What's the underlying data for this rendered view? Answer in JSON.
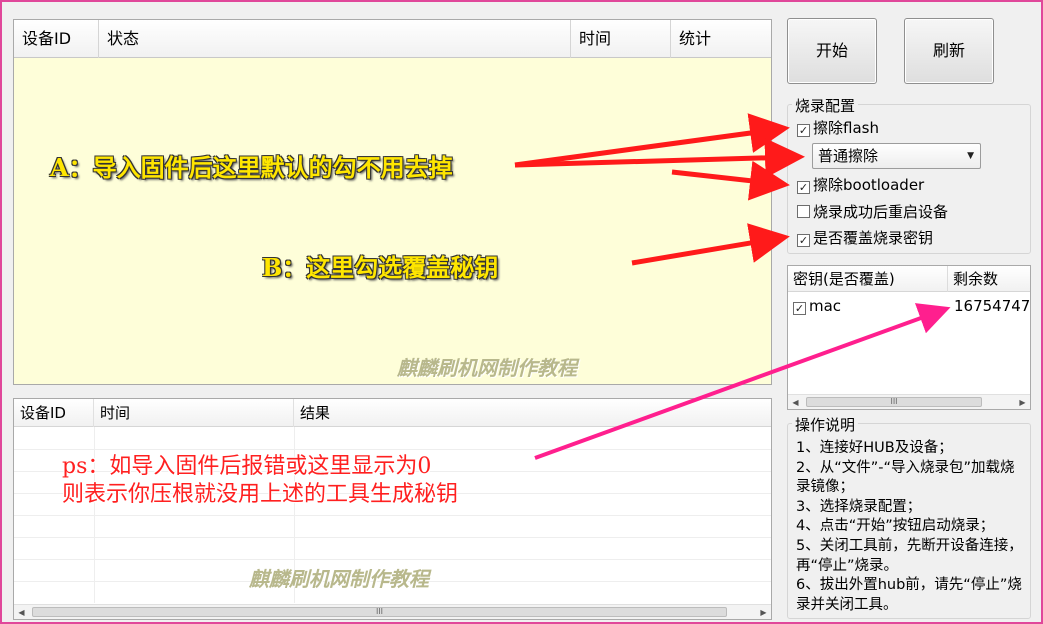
{
  "device_table": {
    "columns": [
      "设备ID",
      "状态",
      "时间",
      "统计"
    ]
  },
  "result_table": {
    "columns": [
      "设备ID",
      "时间",
      "结果"
    ],
    "scroll_glyph": "III"
  },
  "buttons": {
    "start": "开始",
    "refresh": "刷新"
  },
  "burn_config": {
    "title": "烧录配置",
    "erase_flash": {
      "label": "擦除flash",
      "checked": true
    },
    "erase_mode": {
      "value": "普通擦除"
    },
    "erase_bootloader": {
      "label": "擦除bootloader",
      "checked": true
    },
    "restart_after": {
      "label": "烧录成功后重启设备",
      "checked": false
    },
    "overwrite_key": {
      "label": "是否覆盖烧录密钥",
      "checked": true
    }
  },
  "key_table": {
    "columns": [
      "密钥(是否覆盖)",
      "剩余数"
    ],
    "rows": [
      {
        "name": "mac",
        "checked": true,
        "remaining": "16754747"
      }
    ],
    "scroll_glyph": "III"
  },
  "instructions": {
    "title": "操作说明",
    "lines": [
      "1、连接好HUB及设备；",
      "2、从“文件”-“导入烧录包”加载烧录镜像；",
      "3、选择烧录配置；",
      "4、点击“开始”按钮启动烧录；",
      "5、关闭工具前，先断开设备连接，再“停止”烧录。",
      "6、拔出外置hub前，请先“停止”烧录并关闭工具。"
    ]
  },
  "annotations": {
    "a": "A：导入固件后这里默认的勾不用去掉",
    "b": "B：这里勾选覆盖秘钥",
    "ps_line1": "ps：如导入固件后报错或这里显示为0",
    "ps_line2": "则表示你压根就没用上述的工具生成秘钥",
    "watermark": "麒麟刷机网制作教程",
    "color_yellow": "#ffe600",
    "color_red": "#ff1a1a",
    "color_pink": "#ff1f8e"
  }
}
